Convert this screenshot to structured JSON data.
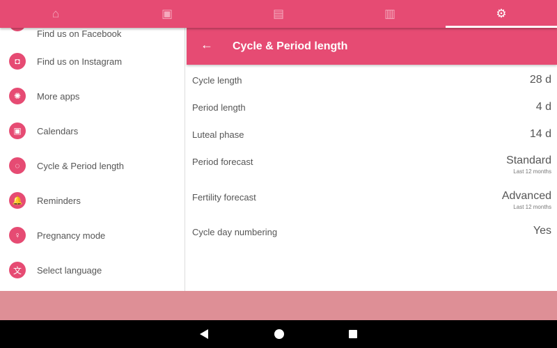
{
  "colors": {
    "accent": "#e64b73",
    "bottom": "#de8f96"
  },
  "tabs": [
    {
      "icon": "home-icon",
      "glyph": "⌂"
    },
    {
      "icon": "calendar-icon",
      "glyph": "▣"
    },
    {
      "icon": "statistics-icon",
      "glyph": "▤"
    },
    {
      "icon": "book-icon",
      "glyph": "▥"
    },
    {
      "icon": "settings-icon",
      "glyph": "⚙",
      "active": true
    }
  ],
  "sidebar": {
    "items": [
      {
        "label": "Find us on Facebook",
        "glyph": "f"
      },
      {
        "label": "Find us on Instagram",
        "glyph": "◘"
      },
      {
        "label": "More apps",
        "glyph": "✺"
      },
      {
        "label": "Calendars",
        "glyph": "▣"
      },
      {
        "label": "Cycle & Period length",
        "glyph": "◌"
      },
      {
        "label": "Reminders",
        "glyph": "🔔"
      },
      {
        "label": "Pregnancy mode",
        "glyph": "♀"
      },
      {
        "label": "Select language",
        "glyph": "文"
      }
    ]
  },
  "header": {
    "title": "Cycle & Period length",
    "back": "←"
  },
  "settings": [
    {
      "label": "Cycle length",
      "value": "28 d"
    },
    {
      "label": "Period length",
      "value": "4 d"
    },
    {
      "label": "Luteal phase",
      "value": "14 d"
    },
    {
      "label": "Period forecast",
      "value": "Standard",
      "sub": "Last 12 months"
    },
    {
      "label": "Fertility forecast",
      "value": "Advanced",
      "sub": "Last 12 months"
    },
    {
      "label": "Cycle day numbering",
      "value": "Yes"
    }
  ]
}
